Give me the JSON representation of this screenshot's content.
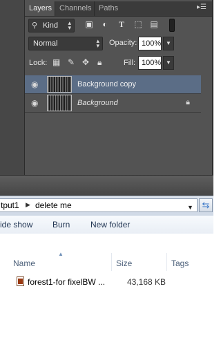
{
  "photoshop": {
    "tabs": [
      "Layers",
      "Channels",
      "Paths"
    ],
    "panel_menu_icon": "menu-lines-icon",
    "filter": {
      "kind_label": "Kind"
    },
    "blend": {
      "mode": "Normal",
      "opacity_label": "Opacity:",
      "opacity": "100%"
    },
    "lock": {
      "label": "Lock:",
      "fill_label": "Fill:",
      "fill": "100%"
    },
    "layers": [
      {
        "name": "Background copy",
        "selected": true,
        "visible": true,
        "locked": false
      },
      {
        "name": "Background",
        "selected": false,
        "visible": true,
        "locked": true
      }
    ]
  },
  "explorer": {
    "breadcrumbs": [
      "tput1",
      "delete me"
    ],
    "toolbar": {
      "slide_show": "ide show",
      "burn": "Burn",
      "new_folder": "New folder"
    },
    "columns": {
      "name": "Name",
      "size": "Size",
      "tags": "Tags"
    },
    "files": [
      {
        "name": "forest1-for fixelBW ...",
        "size": "43,168 KB"
      }
    ]
  }
}
